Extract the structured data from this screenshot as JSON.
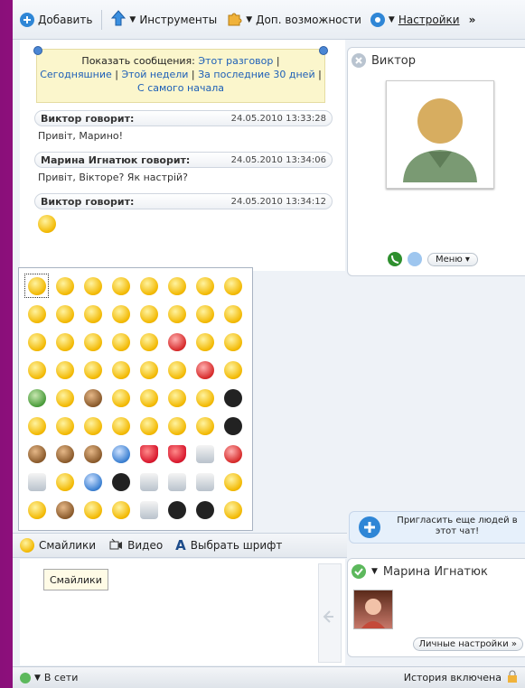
{
  "toolbar": {
    "add": "Добавить",
    "tools": "Инструменты",
    "extras": "Доп. возможности",
    "settings": "Настройки",
    "more": "»"
  },
  "filter": {
    "prefix": "Показать сообщения:",
    "this_conv": "Этот разговор",
    "today": "Сегодняшние",
    "week": "Этой недели",
    "last30": "За последние 30 дней",
    "beginning": "С самого начала"
  },
  "messages": [
    {
      "author": "Виктор говорит:",
      "time": "24.05.2010 13:33:28",
      "text": "Привіт, Марино!"
    },
    {
      "author": "Марина Игнатюк говорит:",
      "time": "24.05.2010 13:34:06",
      "text": "Привіт, Вікторе? Як настрій?"
    },
    {
      "author": "Виктор говорит:",
      "time": "24.05.2010 13:34:12",
      "text": ""
    }
  ],
  "bottom_bar": {
    "smileys": "Смайлики",
    "video": "Видео",
    "font": "Выбрать шрифт"
  },
  "tooltip": "Смайлики",
  "contact_panel": {
    "name": "Виктор",
    "menu": "Меню"
  },
  "invite": "Пригласить еще людей в этот чат!",
  "self_panel": {
    "name": "Марина Игнатюк",
    "settings": "Личные настройки »"
  },
  "status": {
    "state": "В сети",
    "history": "История включена"
  },
  "colors": {
    "background": "#b51496",
    "link": "#1d5fb7",
    "notice": "#fbf6cc"
  },
  "emoji_rows": [
    [
      "y",
      "y",
      "y",
      "y",
      "y",
      "y",
      "y",
      "y"
    ],
    [
      "y",
      "y",
      "y",
      "y",
      "y",
      "y",
      "y",
      "y"
    ],
    [
      "y",
      "y",
      "y",
      "y",
      "y",
      "r",
      "y",
      "y"
    ],
    [
      "y",
      "y",
      "y",
      "y",
      "y",
      "y",
      "r",
      "y"
    ],
    [
      "g",
      "y",
      "br",
      "y",
      "y",
      "y",
      "y",
      "k"
    ],
    [
      "y",
      "y",
      "y",
      "y",
      "y",
      "y",
      "y",
      "k"
    ],
    [
      "br",
      "br",
      "br",
      "b",
      "h",
      "h",
      "w",
      "r"
    ],
    [
      "w",
      "y",
      "b",
      "k",
      "w",
      "w",
      "w",
      "y"
    ],
    [
      "y",
      "br",
      "y",
      "y",
      "w",
      "k",
      "k",
      "y"
    ]
  ]
}
